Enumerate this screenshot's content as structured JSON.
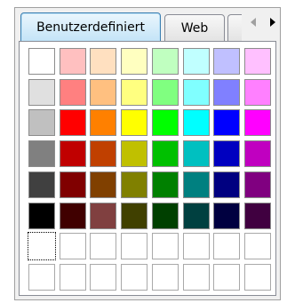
{
  "tabs": [
    {
      "label": "Benutzerdefiniert",
      "active": true
    },
    {
      "label": "Web",
      "active": false
    }
  ],
  "scroll": {
    "left_icon": "triangle-left-icon",
    "right_icon": "triangle-right-icon",
    "left_enabled": false,
    "right_enabled": true
  },
  "palette": {
    "columns": 8,
    "rows": [
      [
        "#FFFFFF",
        "#FFC0C0",
        "#FFE0C0",
        "#FFFFC0",
        "#C0FFC0",
        "#C0FFFF",
        "#C0C0FF",
        "#FFC0FF"
      ],
      [
        "#E0E0E0",
        "#FF8080",
        "#FFC080",
        "#FFFF80",
        "#80FF80",
        "#80FFFF",
        "#8080FF",
        "#FF80FF"
      ],
      [
        "#C0C0C0",
        "#FF0000",
        "#FF8000",
        "#FFFF00",
        "#00FF00",
        "#00FFFF",
        "#0000FF",
        "#FF00FF"
      ],
      [
        "#808080",
        "#C00000",
        "#C04000",
        "#C0C000",
        "#00C000",
        "#00C0C0",
        "#0000C0",
        "#C000C0"
      ],
      [
        "#404040",
        "#800000",
        "#804000",
        "#808000",
        "#008000",
        "#008080",
        "#000080",
        "#800080"
      ],
      [
        "#000000",
        "#400000",
        "#804040",
        "#404000",
        "#004000",
        "#004040",
        "#000040",
        "#400040"
      ]
    ],
    "custom_rows": [
      [
        null,
        null,
        null,
        null,
        null,
        null,
        null,
        null
      ],
      [
        null,
        null,
        null,
        null,
        null,
        null,
        null,
        null
      ]
    ],
    "selected": {
      "section": "custom",
      "row": 0,
      "col": 0
    }
  }
}
